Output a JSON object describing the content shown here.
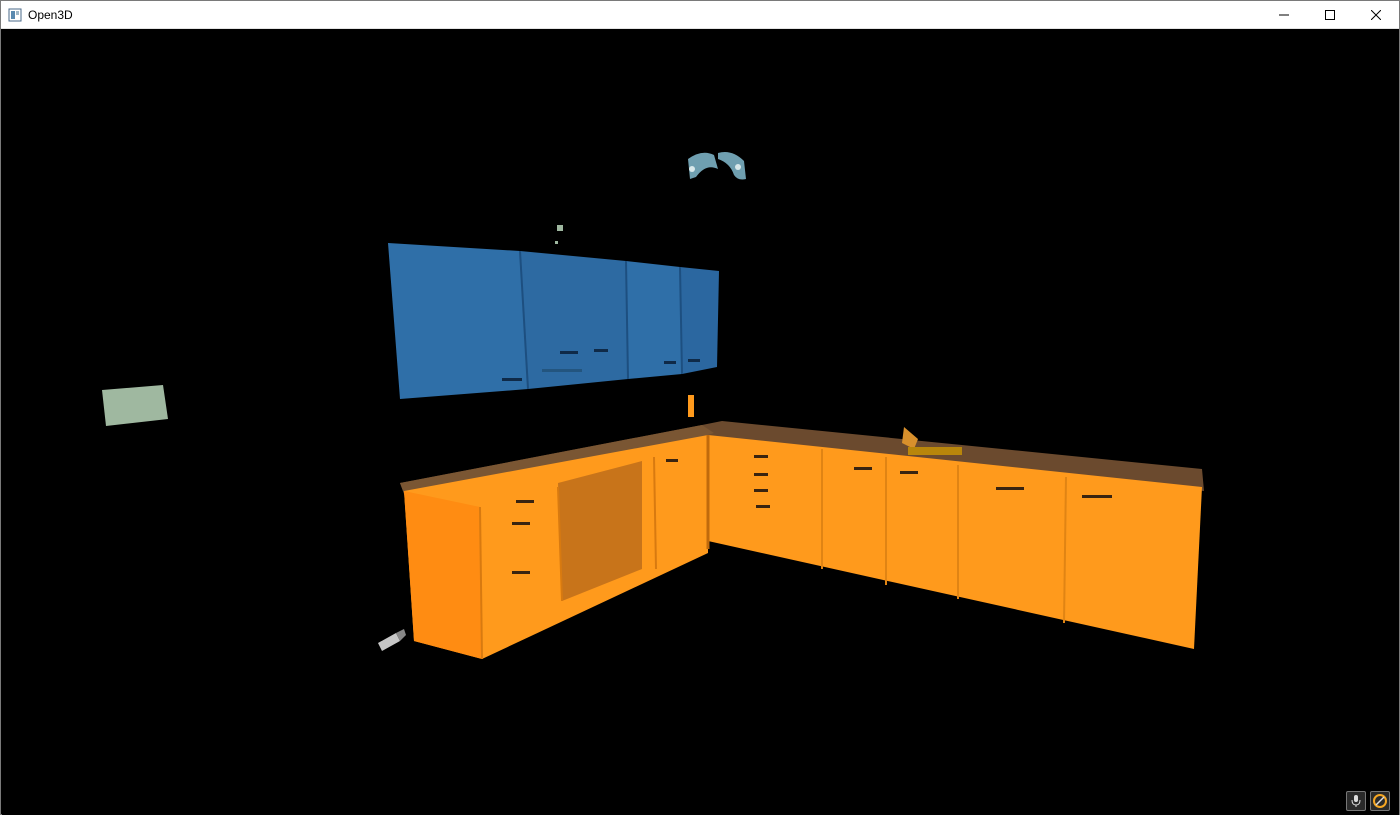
{
  "window": {
    "title": "Open3D",
    "controls": [
      "minimize-icon",
      "maximize-icon",
      "close-icon"
    ]
  },
  "scene": {
    "background": "#000000",
    "objects": [
      {
        "name": "upper-cabinets",
        "color": "#2f6fa8"
      },
      {
        "name": "lower-counter",
        "color": "#ff9a1c"
      },
      {
        "name": "wall-picture",
        "color": "#9fb8a0"
      },
      {
        "name": "ceiling-lamp",
        "color": "#6f9fb0"
      },
      {
        "name": "floor-object",
        "color": "#c7c7c7"
      }
    ]
  },
  "overlay": {
    "buttons": [
      "microphone-icon",
      "color-wheel-icon"
    ]
  }
}
